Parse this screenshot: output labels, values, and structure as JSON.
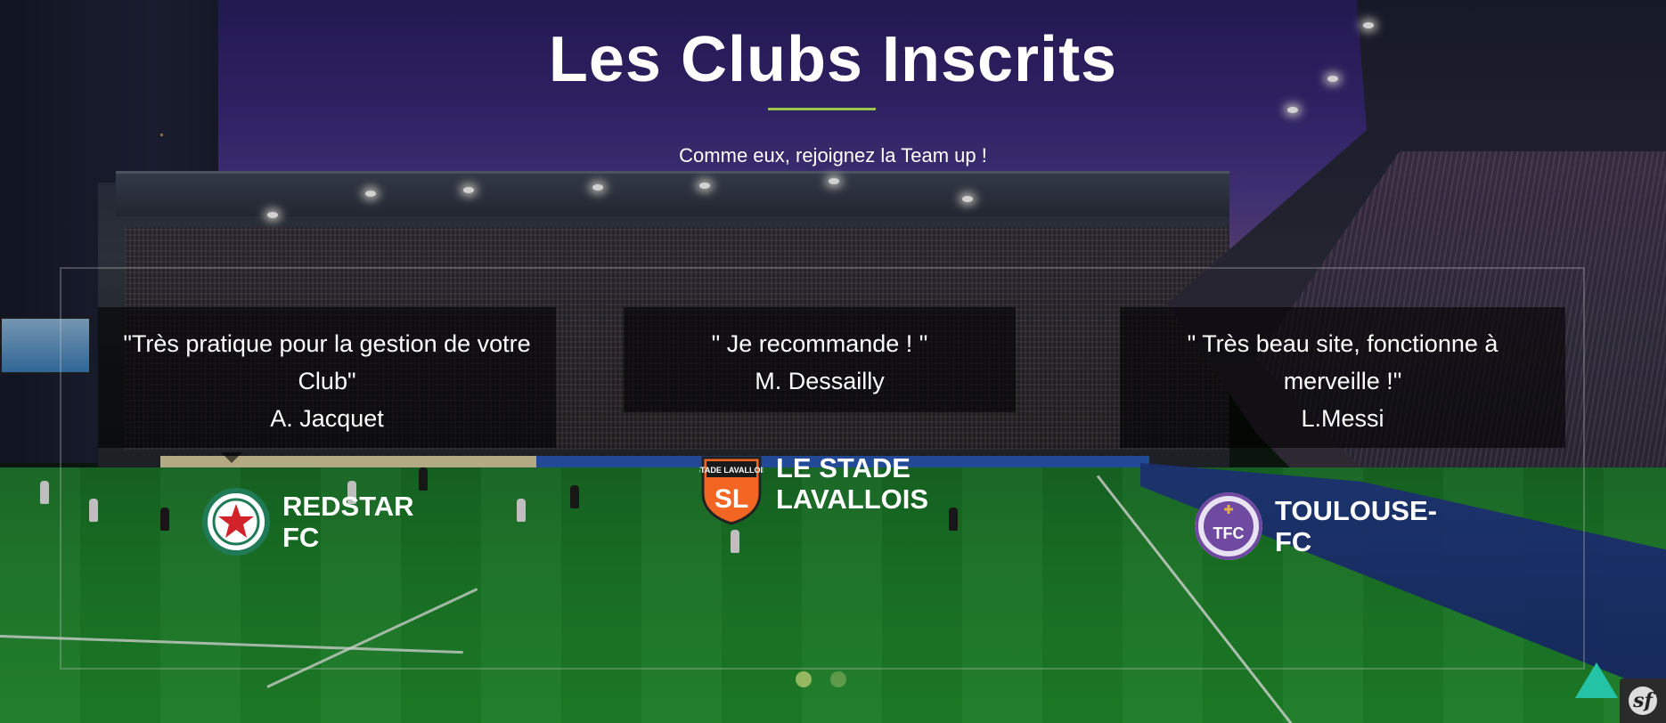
{
  "section": {
    "title": "Les Clubs Inscrits",
    "subtitle": "Comme eux, rejoignez la Team up !"
  },
  "testimonials": [
    {
      "quote": "\"Très pratique pour la gestion de votre Club\"",
      "author": "A. Jacquet",
      "club": "REDSTAR FC",
      "club_line1": "REDSTAR",
      "club_line2": "FC",
      "logo_icon": "red-star-icon",
      "logo_color": "#d3232a"
    },
    {
      "quote": "\" Je recommande ! \"",
      "author": "M. Dessailly",
      "club": "LE STADE LAVALLOIS",
      "club_line1": "LE STADE",
      "club_line2": "LAVALLOIS",
      "logo_icon": "stade-lavallois-shield-icon",
      "logo_color": "#f26522",
      "logo_text_top": "STADE LAVALLOIS",
      "logo_text_main": "SL"
    },
    {
      "quote": "\" Très beau site, fonctionne à merveille !\"",
      "author": "L.Messi",
      "club": "TOULOUSE-FC",
      "club_line1": "TOULOUSE-",
      "club_line2": "FC",
      "logo_icon": "toulouse-fc-badge-icon",
      "logo_color": "#6f4aa0",
      "logo_text_main": "TFC"
    }
  ],
  "carousel": {
    "active_index": 0,
    "page_count": 2
  },
  "colors": {
    "accent_underline": "#9bc64d",
    "scroll_top": "#25c3a6"
  },
  "icons": {
    "scroll_top": "arrow-up-icon",
    "debug_toolbar": "symfony-icon"
  },
  "debug_toolbar_label": "sf"
}
